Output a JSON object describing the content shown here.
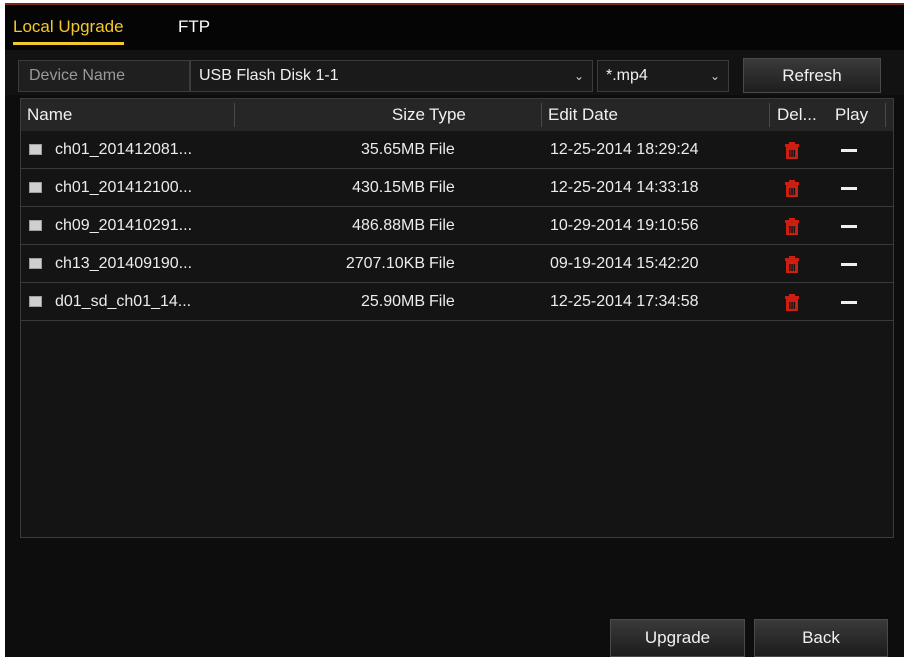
{
  "tabs": [
    {
      "label": "Local Upgrade",
      "active": true
    },
    {
      "label": "FTP",
      "active": false
    }
  ],
  "toolbar": {
    "device_label": "Device Name",
    "device_value": "USB Flash Disk 1-1",
    "type_value": "*.mp4",
    "refresh_label": "Refresh"
  },
  "table": {
    "columns": [
      "Name",
      "Size",
      "Type",
      "Edit Date",
      "Del...",
      "Play"
    ],
    "rows": [
      {
        "name": "ch01_201412081...",
        "size": "35.65MB",
        "type": "File",
        "date": "12-25-2014 18:29:24"
      },
      {
        "name": "ch01_201412100...",
        "size": "430.15MB",
        "type": "File",
        "date": "12-25-2014 14:33:18"
      },
      {
        "name": "ch09_201410291...",
        "size": "486.88MB",
        "type": "File",
        "date": "10-29-2014 19:10:56"
      },
      {
        "name": "ch13_201409190...",
        "size": "2707.10KB",
        "type": "File",
        "date": "09-19-2014 15:42:20"
      },
      {
        "name": "d01_sd_ch01_14...",
        "size": "25.90MB",
        "type": "File",
        "date": "12-25-2014 17:34:58"
      }
    ]
  },
  "buttons": {
    "upgrade": "Upgrade",
    "back": "Back"
  },
  "icons": {
    "file": "file-icon",
    "delete": "trash-icon",
    "play": "dash-icon"
  },
  "colors": {
    "accent": "#f3c82b",
    "delete": "#cc1f12"
  }
}
